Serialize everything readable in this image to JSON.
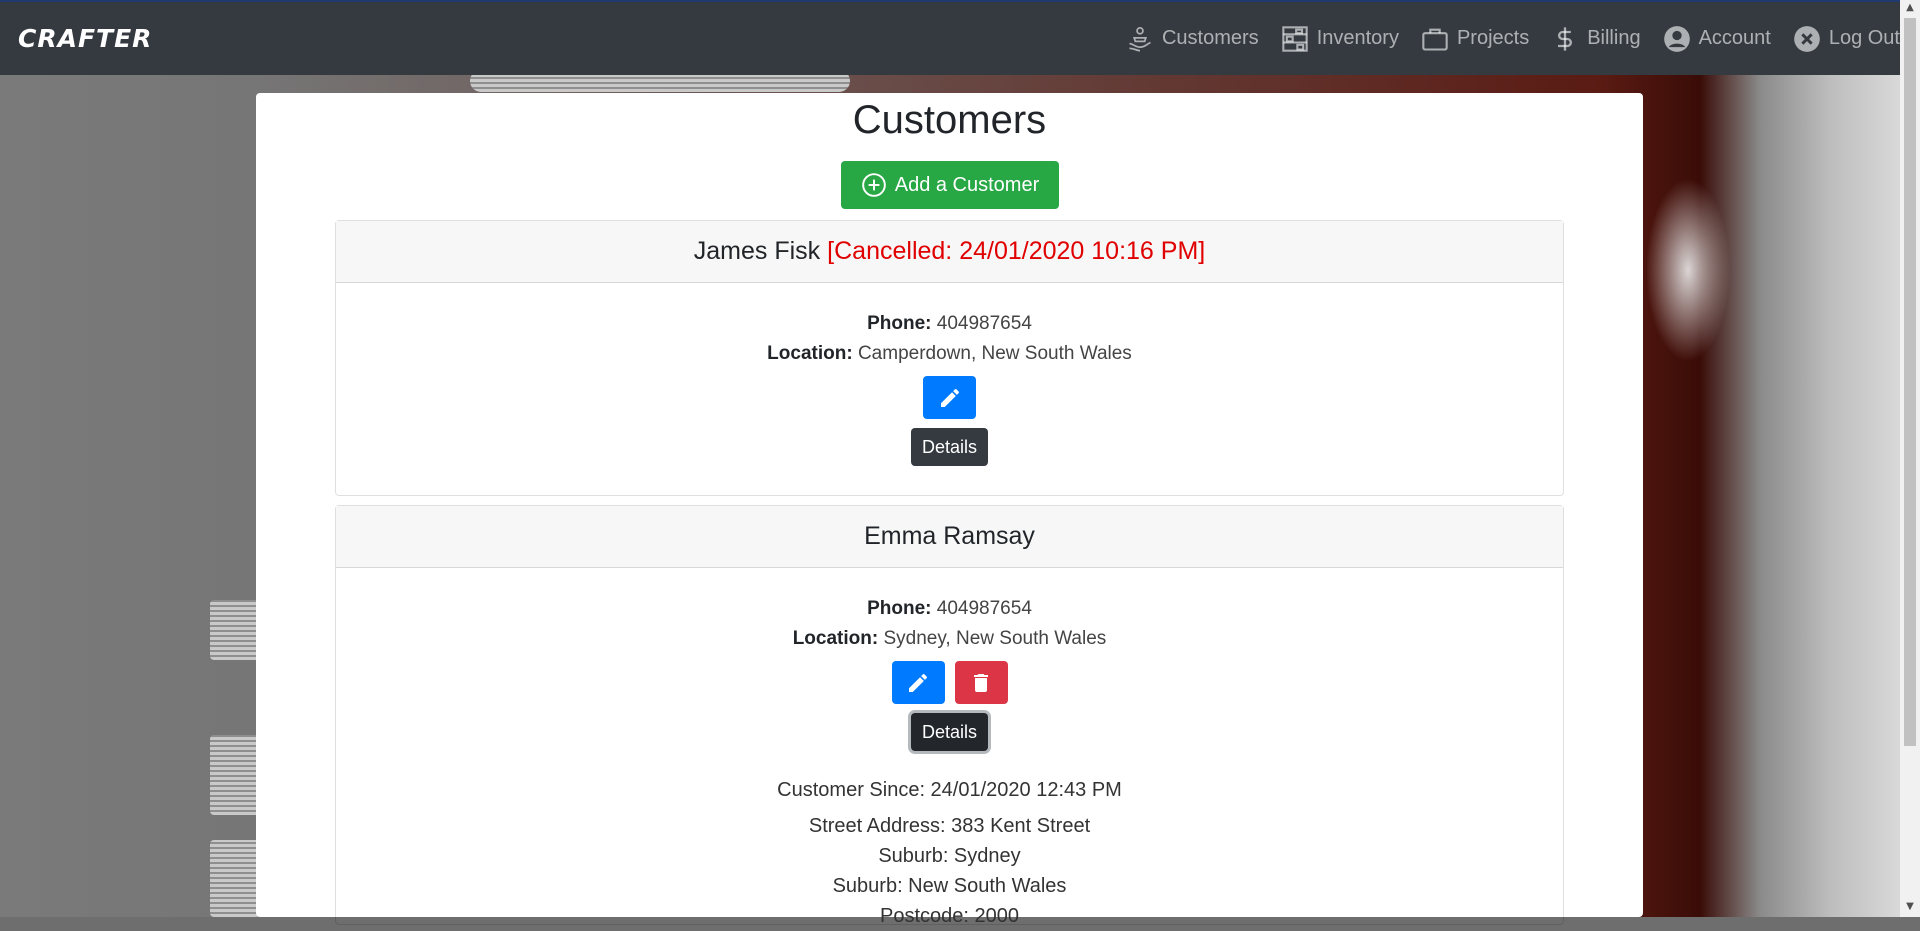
{
  "navbar": {
    "brand": "CRAFTER",
    "items": [
      {
        "label": "Customers",
        "icon": "customers-icon"
      },
      {
        "label": "Inventory",
        "icon": "inventory-icon"
      },
      {
        "label": "Projects",
        "icon": "briefcase-icon"
      },
      {
        "label": "Billing",
        "icon": "dollar-icon"
      },
      {
        "label": "Account",
        "icon": "account-icon"
      },
      {
        "label": "Log Out",
        "icon": "close-circle-icon"
      }
    ]
  },
  "page": {
    "title": "Customers",
    "add_button": "Add a Customer"
  },
  "customers": [
    {
      "name": "James Fisk",
      "status": "[Cancelled: 24/01/2020 10:16 PM]",
      "phone_label": "Phone:",
      "phone": "404987654",
      "location_label": "Location:",
      "location": "Camperdown, New South Wales",
      "details_label": "Details"
    },
    {
      "name": "Emma Ramsay",
      "phone_label": "Phone:",
      "phone": "404987654",
      "location_label": "Location:",
      "location": "Sydney, New South Wales",
      "details_label": "Details",
      "details": {
        "customer_since": "Customer Since: 24/01/2020 12:43 PM",
        "street": "Street Address: 383 Kent Street",
        "suburb": "Suburb: Sydney",
        "state": "Suburb: New South Wales",
        "postcode": "Postcode: 2000"
      }
    }
  ],
  "colors": {
    "navbar": "#343a40",
    "success": "#28a745",
    "primary": "#007bff",
    "danger": "#dc3545",
    "cancelled": "#e00000"
  }
}
